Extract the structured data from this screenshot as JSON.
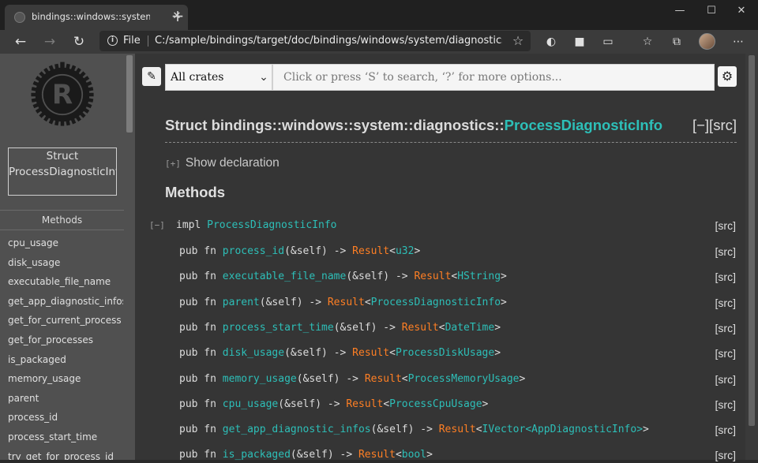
{
  "browser": {
    "tab_title": "bindings::windows::system::diagnostics::ProcessDiagnosticInfo",
    "tab_close": "✕",
    "new_tab": "+",
    "window_minimize": "—",
    "window_maximize": "☐",
    "window_close": "✕",
    "scheme_label": "File",
    "url": "C:/sample/bindings/target/doc/bindings/windows/system/diagnostics/..."
  },
  "sidebar": {
    "struct_box": "Struct ProcessDiagnosticInfo",
    "methods_heading": "Methods",
    "items": [
      "cpu_usage",
      "disk_usage",
      "executable_file_name",
      "get_app_diagnostic_infos",
      "get_for_current_process",
      "get_for_processes",
      "is_packaged",
      "memory_usage",
      "parent",
      "process_id",
      "process_start_time",
      "try_get_for_process_id"
    ]
  },
  "search": {
    "crate_select": "All crates",
    "placeholder": "Click or press ‘S’ to search, ‘?’ for more options..."
  },
  "main": {
    "fqn_prefix": "Struct bindings::windows::system::diagnostics::",
    "fqn_name": "ProcessDiagnosticInfo",
    "fqn_toggle_src": "[−][src]",
    "show_decl_toggle": "[+]",
    "show_decl": "Show declaration",
    "methods_title": "Methods",
    "impl_toggle": "[−]",
    "impl_kw": "impl",
    "impl_type": "ProcessDiagnosticInfo",
    "src_label": "[src]",
    "methods": [
      {
        "name": "process_id",
        "args": "(&self) -> ",
        "result": "Result",
        "open": "<",
        "type": "u32",
        "close": ">"
      },
      {
        "name": "executable_file_name",
        "args": "(&self) -> ",
        "result": "Result",
        "open": "<",
        "type": "HString",
        "close": ">"
      },
      {
        "name": "parent",
        "args": "(&self) -> ",
        "result": "Result",
        "open": "<",
        "type": "ProcessDiagnosticInfo",
        "close": ">"
      },
      {
        "name": "process_start_time",
        "args": "(&self) -> ",
        "result": "Result",
        "open": "<",
        "type": "DateTime",
        "close": ">"
      },
      {
        "name": "disk_usage",
        "args": "(&self) -> ",
        "result": "Result",
        "open": "<",
        "type": "ProcessDiskUsage",
        "close": ">"
      },
      {
        "name": "memory_usage",
        "args": "(&self) -> ",
        "result": "Result",
        "open": "<",
        "type": "ProcessMemoryUsage",
        "close": ">"
      },
      {
        "name": "cpu_usage",
        "args": "(&self) -> ",
        "result": "Result",
        "open": "<",
        "type": "ProcessCpuUsage",
        "close": ">"
      },
      {
        "name": "get_app_diagnostic_infos",
        "args": "(&self) -> ",
        "result": "Result",
        "open": "<",
        "type": "IVector<AppDiagnosticInfo>",
        "close": ">"
      },
      {
        "name": "is_packaged",
        "args": "(&self) -> ",
        "result": "Result",
        "open": "<",
        "type": "bool",
        "close": ">"
      }
    ],
    "pub_fn": "pub fn"
  }
}
